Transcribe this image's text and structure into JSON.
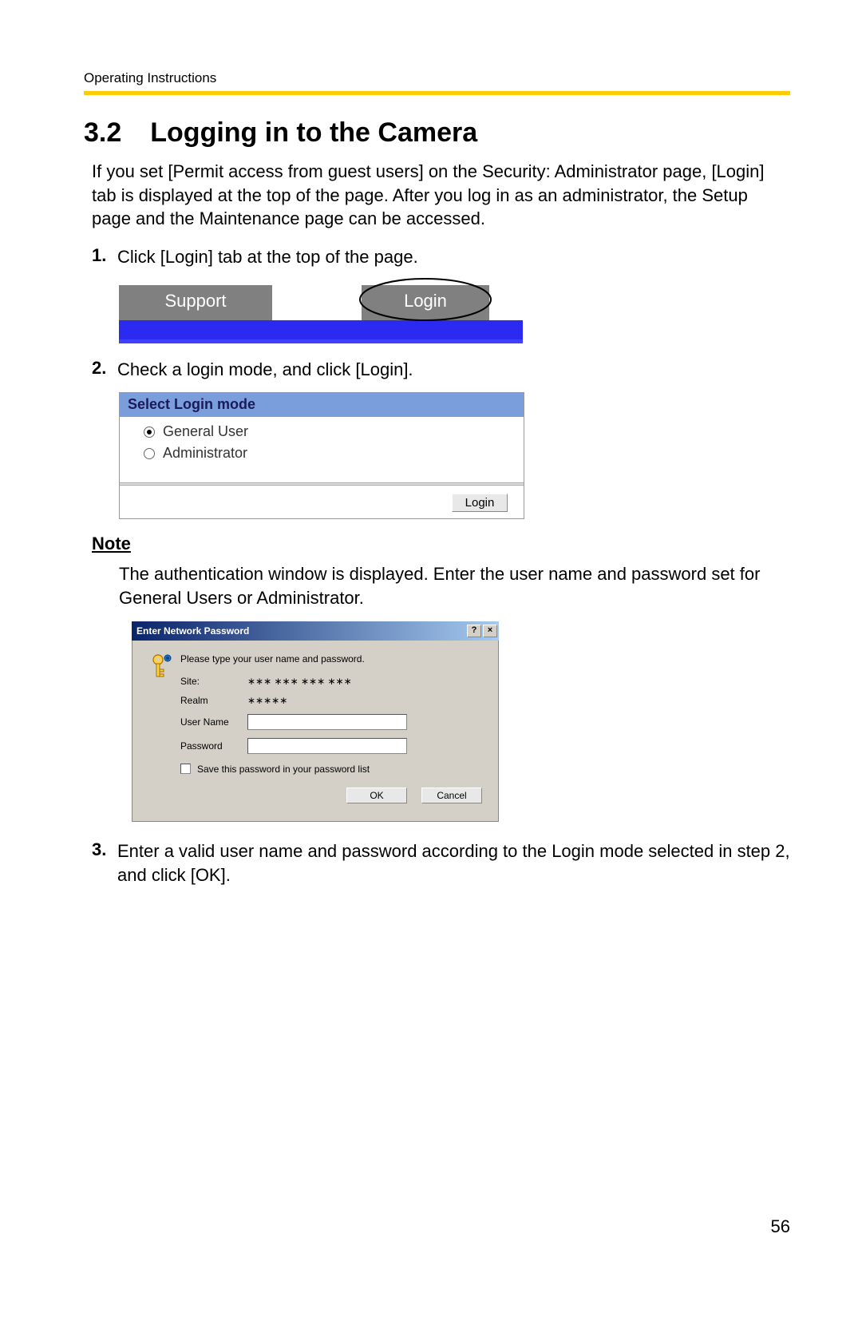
{
  "header": {
    "running": "Operating Instructions"
  },
  "section": {
    "number": "3.2",
    "title": "Logging in to the Camera",
    "intro": "If you set [Permit access from guest users] on the Security: Administrator page, [Login] tab is displayed at the top of the page. After you log in as an administrator, the Setup page and the Maintenance page can be accessed."
  },
  "steps": {
    "s1": {
      "num": "1.",
      "text": "Click [Login] tab at the top of the page."
    },
    "s2": {
      "num": "2.",
      "text": "Check a login mode, and click [Login]."
    },
    "s3": {
      "num": "3.",
      "text": "Enter a valid user name and password according to the Login mode selected in step 2, and click [OK]."
    }
  },
  "fig1": {
    "support_label": "Support",
    "login_label": "Login"
  },
  "fig2": {
    "title": "Select Login mode",
    "opt1": "General User",
    "opt2": "Administrator",
    "login_btn": "Login"
  },
  "note": {
    "heading": "Note",
    "text": "The authentication window is displayed. Enter the user name and password set for General Users or Administrator."
  },
  "fig3": {
    "title": "Enter Network Password",
    "help_btn": "?",
    "close_btn": "×",
    "msg": "Please type your user name and password.",
    "site_label": "Site:",
    "site_value": "∗∗∗ ∗∗∗ ∗∗∗ ∗∗∗",
    "realm_label": "Realm",
    "realm_value": "∗∗∗∗∗",
    "user_label": "User Name",
    "pass_label": "Password",
    "save_label": "Save this password in your password list",
    "ok_btn": "OK",
    "cancel_btn": "Cancel"
  },
  "page_number": "56"
}
